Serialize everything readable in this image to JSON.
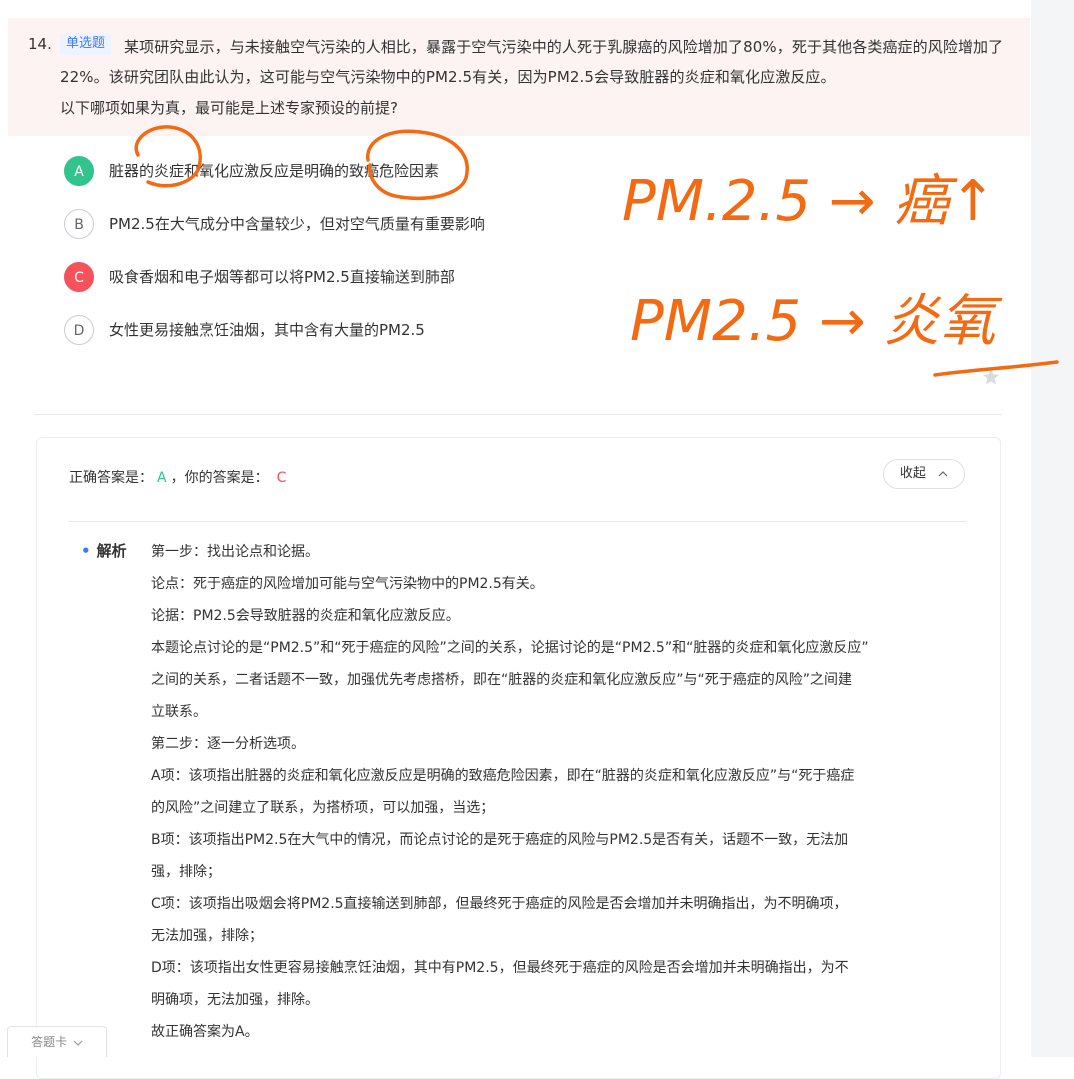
{
  "question": {
    "number": "14.",
    "type_badge": "单选题",
    "stem": "某项研究显示，与未接触空气污染的人相比，暴露于空气污染中的人死于乳腺癌的风险增加了80%，死于其他各类癌症的风险增加了22%。该研究团队由此认为，这可能与空气污染物中的PM2.5有关，因为PM2.5会导致脏器的炎症和氧化应激反应。",
    "prompt": "以下哪项如果为真，最可能是上述专家预设的前提?",
    "options": [
      {
        "letter": "A",
        "text": "脏器的炎症和氧化应激反应是明确的致癌危险因素",
        "state": "correct"
      },
      {
        "letter": "B",
        "text": "PM2.5在大气成分中含量较少，但对空气质量有重要影响",
        "state": "normal"
      },
      {
        "letter": "C",
        "text": "吸食香烟和电子烟等都可以将PM2.5直接输送到肺部",
        "state": "wrong"
      },
      {
        "letter": "D",
        "text": "女性更易接触烹饪油烟，其中含有大量的PM2.5",
        "state": "normal"
      }
    ]
  },
  "answer": {
    "correct_label": "正确答案是：",
    "correct_value": "A",
    "yours_label": "，你的答案是：",
    "yours_value": "C",
    "collapse_label": "收起"
  },
  "analysis": {
    "heading": "解析",
    "lines": [
      "第一步：找出论点和论据。",
      "论点：死于癌症的风险增加可能与空气污染物中的PM2.5有关。",
      "论据：PM2.5会导致脏器的炎症和氧化应激反应。",
      "本题论点讨论的是“PM2.5”和“死于癌症的风险”之间的关系，论据讨论的是“PM2.5”和“脏器的炎症和氧化应激反应”",
      "之间的关系，二者话题不一致，加强优先考虑搭桥，即在“脏器的炎症和氧化应激反应”与“死于癌症的风险”之间建",
      "立联系。",
      "第二步：逐一分析选项。",
      "A项：该项指出脏器的炎症和氧化应激反应是明确的致癌危险因素，即在“脏器的炎症和氧化应激反应”与“死于癌症",
      "的风险”之间建立了联系，为搭桥项，可以加强，当选；",
      "B项：该项指出PM2.5在大气中的情况，而论点讨论的是死于癌症的风险与PM2.5是否有关，话题不一致，无法加",
      "强，排除；",
      "C项：该项指出吸烟会将PM2.5直接输送到肺部，但最终死于癌症的风险是否会增加并未明确指出，为不明确项，",
      "无法加强，排除；",
      "D项：该项指出女性更容易接触烹饪油烟，其中有PM2.5，但最终死于癌症的风险是否会增加并未明确指出，为不",
      "明确项，无法加强，排除。",
      "故正确答案为A。"
    ]
  },
  "answer_sheet_tab": "答题卡",
  "annotations": {
    "line1": "PM.2.5 → 癌↑",
    "line2": "PM2.5 → 炎氧"
  },
  "colors": {
    "correct": "#31c48d",
    "wrong": "#f5525c",
    "badge": "#3d7bf0",
    "ink": "#f26a12"
  }
}
